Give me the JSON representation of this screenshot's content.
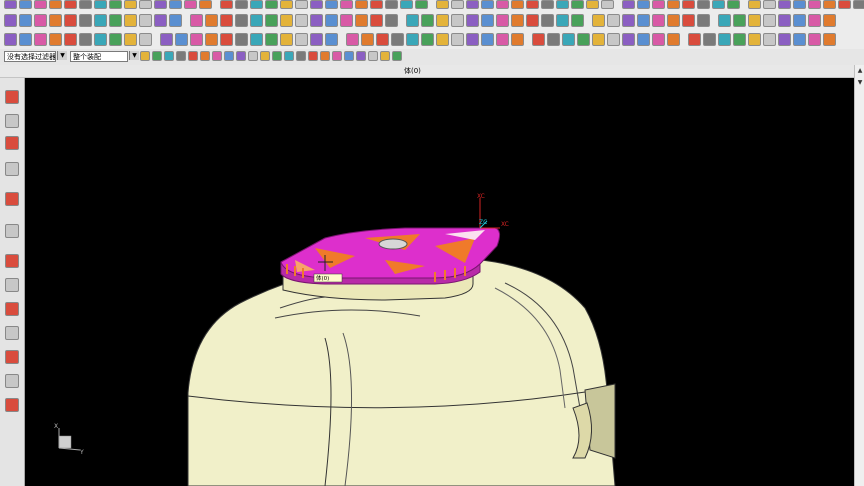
{
  "window": {
    "title": "体(0)"
  },
  "toolbar4": {
    "filter_value": "没有选择过滤器",
    "scope_value": "整个装配"
  },
  "viewport": {
    "wcs_labels": {
      "x": "XC",
      "y": "YC",
      "z": "ZC"
    },
    "absolute_labels": {
      "x": "X",
      "y": "Y"
    },
    "cursor_tag": "体(0)"
  },
  "colors": {
    "background": "#000000",
    "body": "#f1f0c9",
    "body_shade": "#c8c69a",
    "insert_magenta": "#dd2fcc",
    "insert_orange": "#f07a2a",
    "axis_red": "#d42323",
    "axis_cyan": "#22c7d8"
  },
  "icons": {
    "toolbar_row1": [
      "new-file-icon",
      "open-icon",
      "save-icon",
      "undo-icon",
      "redo-icon",
      "cut-icon",
      "copy-icon",
      "paste-icon",
      "delete-icon",
      "print-icon",
      "zoom-icon",
      "pan-icon",
      "rotate-icon",
      "fit-icon",
      "shade-icon",
      "layer-icon"
    ],
    "resource_bar": [
      "assembly-navigator-icon",
      "constraint-navigator-icon",
      "part-navigator-icon",
      "reuse-library-icon",
      "hd3d-tools-icon",
      "web-browser-icon",
      "history-icon",
      "process-studio-icon",
      "manufacturing-wizard-icon",
      "roles-icon",
      "system-materials-icon",
      "palette-icon",
      "system-scenes-icon"
    ]
  }
}
